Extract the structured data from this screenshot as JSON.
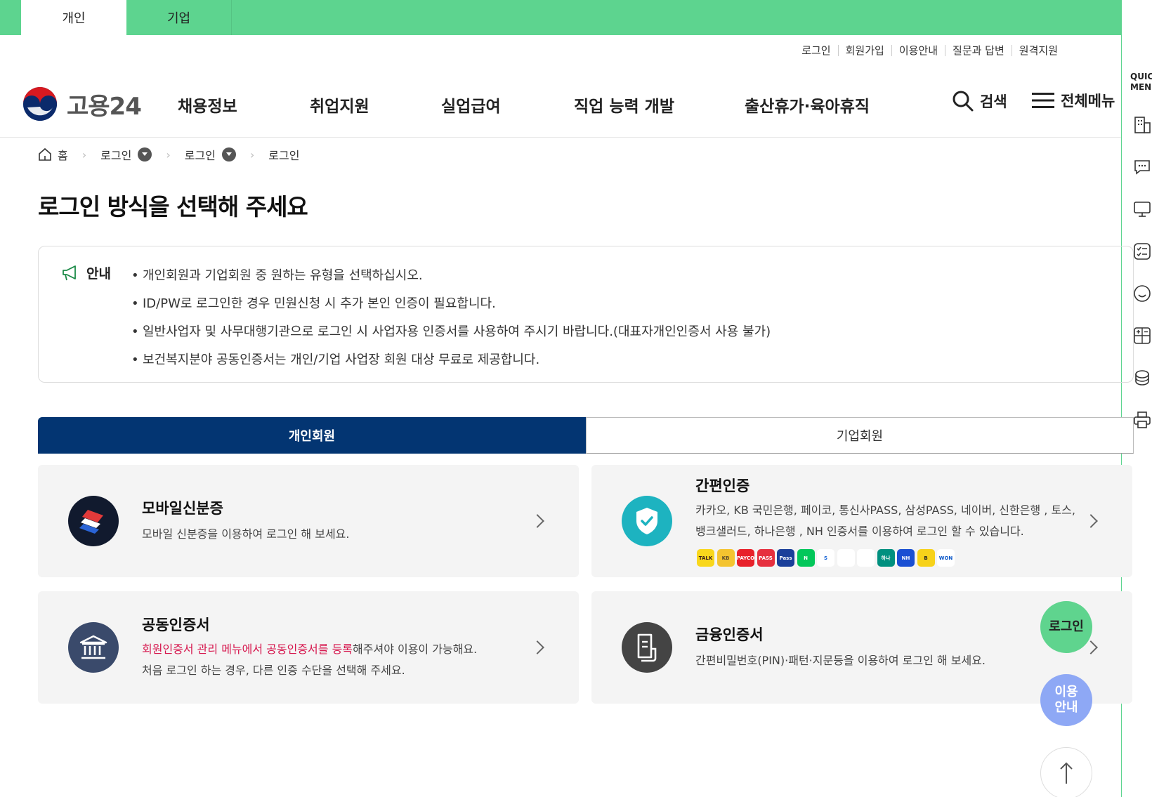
{
  "top_tabs": {
    "personal": "개인",
    "business": "기업"
  },
  "util_links": [
    "로그인",
    "회원가입",
    "이용안내",
    "질문과 답변",
    "원격지원"
  ],
  "logo": {
    "text": "고용24"
  },
  "gnb": {
    "items": [
      "채용정보",
      "취업지원",
      "실업급여",
      "직업 능력 개발",
      "출산휴가·육아휴직"
    ],
    "search": "검색",
    "all_menu": "전체메뉴"
  },
  "quick_menu": {
    "title_line1": "QUIC",
    "title_line2": "MENU"
  },
  "breadcrumb": {
    "home": "홈",
    "level1": "로그인",
    "level2": "로그인",
    "current": "로그인"
  },
  "page_title": "로그인 방식을 선택해 주세요",
  "notice": {
    "label": "안내",
    "items": [
      "개인회원과 기업회원 중 원하는 유형을 선택하십시오.",
      "ID/PW로 로그인한 경우 민원신청 시 추가 본인 인증이 필요합니다.",
      "일반사업자 및 사무대행기관으로 로그인 시 사업자용 인증서를 사용하여 주시기 바랍니다.(대표자개인인증서 사용 불가)",
      "보건복지분야 공동인증서는 개인/기업 사업장 회원 대상 무료로 제공합니다."
    ]
  },
  "member_tabs": {
    "personal": "개인회원",
    "business": "기업회원"
  },
  "cards": {
    "mobile_id": {
      "title": "모바일신분증",
      "desc": "모바일 신분증을 이용하여 로그인 해 보세요."
    },
    "simple_auth": {
      "title": "간편인증",
      "desc_line1": "카카오, KB 국민은행, 페이코, 통신사PASS, 삼성PASS, 네이버, 신한은행 , 토스,",
      "desc_line2": "뱅크샐러드, 하나은행 , NH 인증서를 이용하여 로그인 할 수 있습니다."
    },
    "joint_cert": {
      "title": "공동인증서",
      "desc_highlight": "회원인증서 관리 메뉴에서 공동인증서를 등록",
      "desc_rest": "해주셔야 이용이 가능해요.",
      "desc_line2": "처음 로그인 하는 경우, 다른 인증 수단을 선택해 주세요."
    },
    "financial_cert": {
      "title": "금융인증서",
      "desc": "간편비밀번호(PIN)·패턴·지문등을 이용하여 로그인 해 보세요."
    }
  },
  "brand_icons": [
    {
      "name": "kakao",
      "label": "TALK",
      "color": "#f9d71c",
      "text_color": "#3a1d1d"
    },
    {
      "name": "kb",
      "label": "KB",
      "color": "#f4c430",
      "text_color": "#5a4a2a"
    },
    {
      "name": "payco",
      "label": "PAYCO",
      "color": "#e8212a",
      "text_color": "#ffffff"
    },
    {
      "name": "pass",
      "label": "PASS",
      "color": "#e6303f",
      "text_color": "#ffffff"
    },
    {
      "name": "samsung-pass",
      "label": "Pass",
      "color": "#1b3f9a",
      "text_color": "#ffffff"
    },
    {
      "name": "naver",
      "label": "N",
      "color": "#03c75a",
      "text_color": "#ffffff"
    },
    {
      "name": "shinhan",
      "label": "S",
      "color": "#ffffff",
      "text_color": "#1462d6"
    },
    {
      "name": "toss",
      "label": "",
      "color": "#ffffff",
      "text_color": "#0064ff"
    },
    {
      "name": "banksalad",
      "label": "",
      "color": "#ffffff",
      "text_color": "#00c073"
    },
    {
      "name": "hana",
      "label": "하나",
      "color": "#00907f",
      "text_color": "#ffffff"
    },
    {
      "name": "nh",
      "label": "NH",
      "color": "#1a4fd3",
      "text_color": "#ffffff"
    },
    {
      "name": "b-cert",
      "label": "B",
      "color": "#f7d21a",
      "text_color": "#222222"
    },
    {
      "name": "won",
      "label": "WON",
      "color": "#ffffff",
      "text_color": "#0a56c8"
    }
  ],
  "floating": {
    "login": "로그인",
    "guide_line1": "이용",
    "guide_line2": "안내"
  },
  "colors": {
    "green": "#5dd48f",
    "navy": "#033572",
    "highlight": "#d6164d"
  }
}
